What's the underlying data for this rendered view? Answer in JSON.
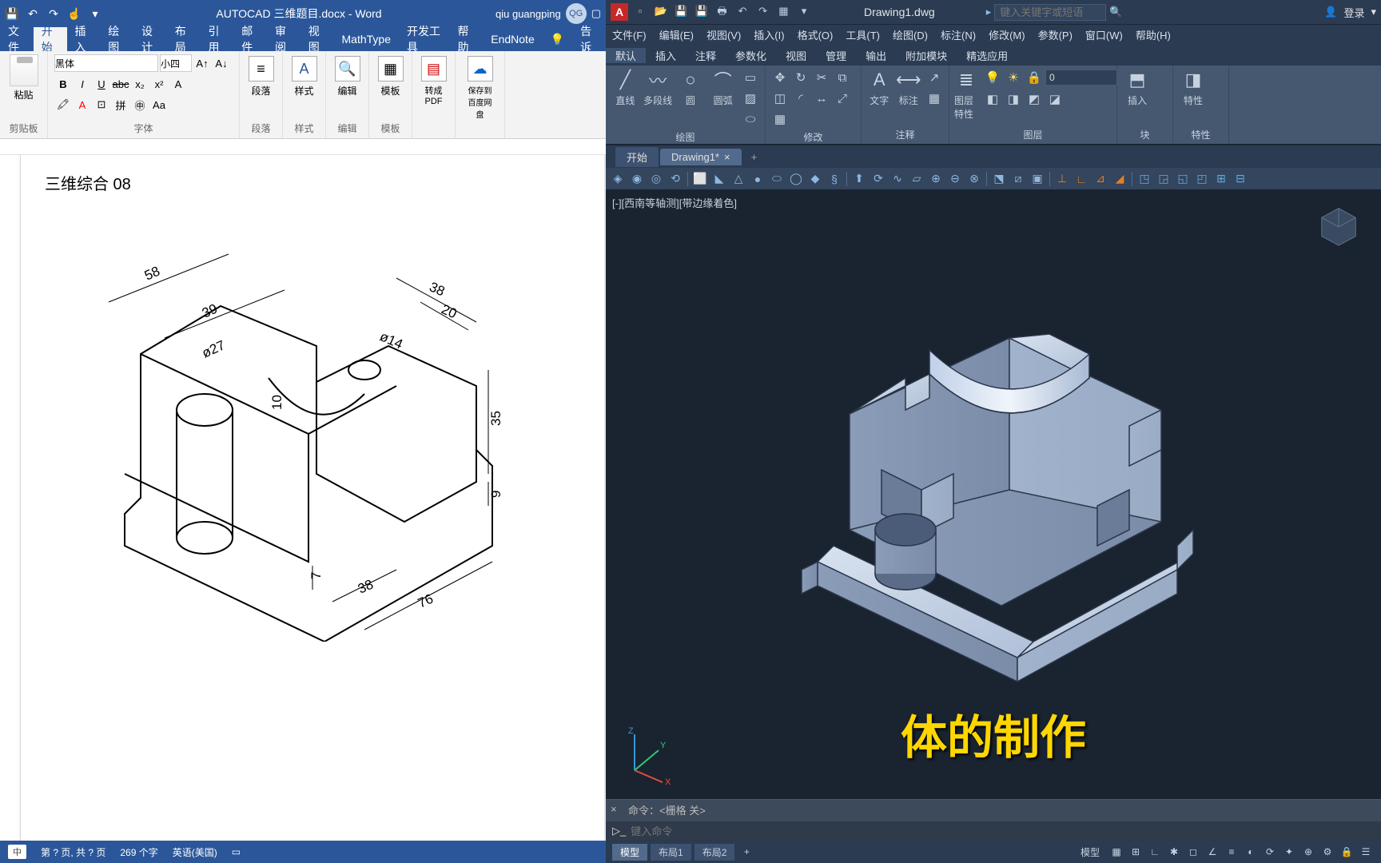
{
  "word": {
    "title": "AUTOCAD 三维题目.docx - Word",
    "user_name": "qiu guangping",
    "user_badge": "QG",
    "qat": [
      "save",
      "undo",
      "redo",
      "touch"
    ],
    "menus": [
      "文件",
      "开始",
      "插入",
      "绘图",
      "设计",
      "布局",
      "引用",
      "邮件",
      "审阅",
      "视图",
      "MathType",
      "开发工具",
      "帮助",
      "EndNote"
    ],
    "active_menu": "开始",
    "tell_me": "告诉",
    "ribbon_groups": {
      "clipboard": {
        "label": "剪贴板",
        "paste": "粘贴"
      },
      "font": {
        "label": "字体",
        "name": "黑体",
        "size": "小四",
        "bold": "B",
        "italic": "I",
        "underline": "U",
        "strike": "abc",
        "sub": "x₂",
        "sup": "x²",
        "clear": "A"
      },
      "para": {
        "label": "段落",
        "btn": "段落"
      },
      "style": {
        "label": "样式",
        "btn": "样式"
      },
      "edit": {
        "label": "编辑",
        "btn": "编辑"
      },
      "template": {
        "label": "模板",
        "btn": "模板"
      },
      "pdf": {
        "label": "转成PDF",
        "btn": "转成PDF"
      },
      "baidu": {
        "label": "保存到百度网盘",
        "btn": "保存到百度网盘"
      }
    },
    "doc_heading": "三维综合 08",
    "dims": {
      "d58": "58",
      "d39": "39",
      "d27": "ø27",
      "d14": "ø14",
      "d38top": "38",
      "d20": "20",
      "d10": "10",
      "d35": "35",
      "d9": "9",
      "d7": "7",
      "d38bot": "38",
      "d76": "76"
    },
    "status": {
      "page": "第 ? 页, 共 ? 页",
      "words": "269 个字",
      "lang": "英语(美国)",
      "ime": "中"
    }
  },
  "cad": {
    "doc_name": "Drawing1.dwg",
    "search_placeholder": "键入关键字或短语",
    "login": "登录",
    "qat": [
      "new",
      "open",
      "save",
      "saveas",
      "plot",
      "undo",
      "redo",
      "app"
    ],
    "menus": [
      "文件(F)",
      "编辑(E)",
      "视图(V)",
      "插入(I)",
      "格式(O)",
      "工具(T)",
      "绘图(D)",
      "标注(N)",
      "修改(M)",
      "参数(P)",
      "窗口(W)",
      "帮助(H)"
    ],
    "ribbon_tabs": [
      "默认",
      "插入",
      "注释",
      "参数化",
      "视图",
      "管理",
      "输出",
      "附加模块",
      "精选应用"
    ],
    "active_ribbon": "默认",
    "groups": {
      "draw": {
        "label": "绘图",
        "line": "直线",
        "pline": "多段线",
        "circle": "圆",
        "arc": "圆弧"
      },
      "modify": {
        "label": "修改"
      },
      "anno": {
        "label": "注释",
        "text": "文字",
        "dim": "标注"
      },
      "layer": {
        "label": "图层",
        "props": "图层特性",
        "current": "0"
      },
      "block": {
        "label": "块",
        "insert": "插入"
      },
      "prop": {
        "label": "特性",
        "btn": "特性"
      }
    },
    "file_tabs": [
      {
        "name": "开始",
        "active": false
      },
      {
        "name": "Drawing1*",
        "active": true
      }
    ],
    "viewport_label": "[-][西南等轴测][带边缘着色]",
    "caption": "体的制作",
    "cmd_hist": "命令：<栅格 关>",
    "cmd_prompt": "键入命令",
    "status_tabs": [
      {
        "n": "模型",
        "a": true
      },
      {
        "n": "布局1",
        "a": false
      },
      {
        "n": "布局2",
        "a": false
      }
    ],
    "status_right_label": "模型"
  }
}
